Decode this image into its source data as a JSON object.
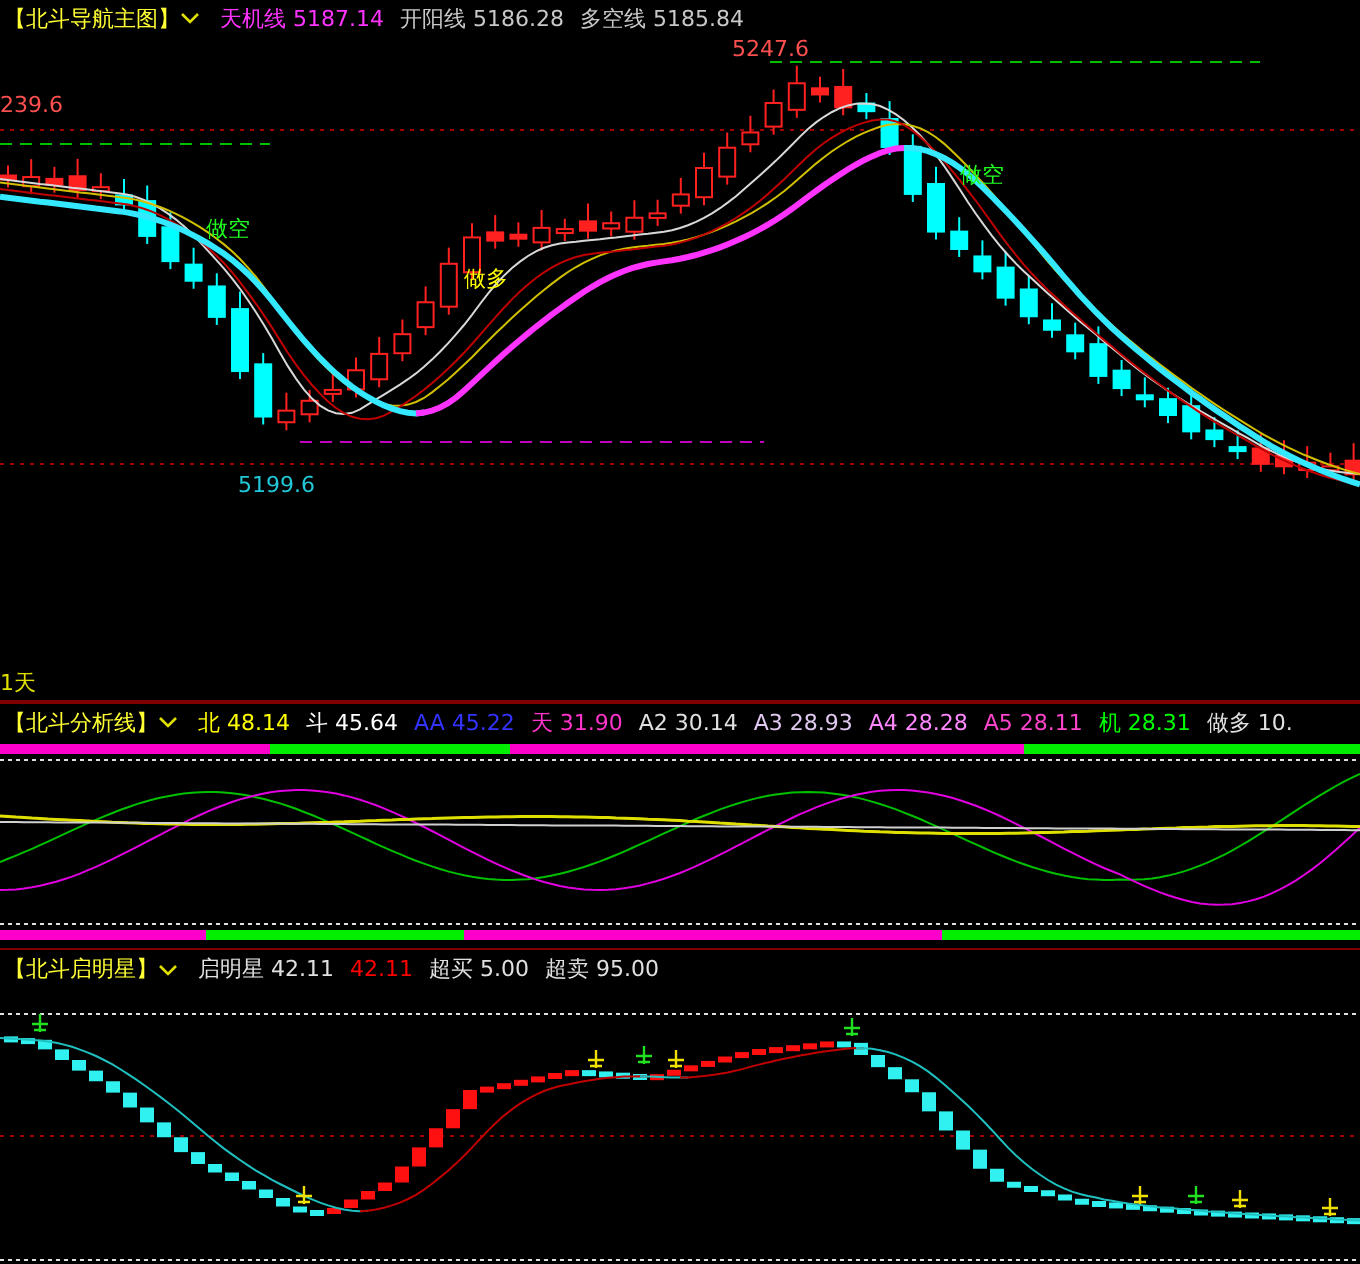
{
  "main_panel": {
    "title": "【北斗导航主图】",
    "indicators": [
      {
        "name": "天机线",
        "value": "5187.14",
        "color": "#ff33ff"
      },
      {
        "name": "开阳线",
        "value": "5186.28",
        "color": "#c8c8c8"
      },
      {
        "name": "多空线",
        "value": "5185.84",
        "color": "#c8c8c8"
      }
    ],
    "price_labels": [
      {
        "text": "5247.6",
        "kind": "high"
      },
      {
        "text": "239.6",
        "kind": "high"
      },
      {
        "text": "5199.6",
        "kind": "low"
      }
    ],
    "signals": [
      {
        "text": "做空",
        "kind": "short"
      },
      {
        "text": "做多",
        "kind": "long"
      },
      {
        "text": "做空",
        "kind": "short"
      }
    ],
    "period": "1天"
  },
  "analysis_panel": {
    "title": "【北斗分析线】",
    "indicators": [
      {
        "name": "北",
        "value": "48.14",
        "color": "#ffff00"
      },
      {
        "name": "斗",
        "value": "45.64",
        "color": "#ffffff"
      },
      {
        "name": "AA",
        "value": "45.22",
        "color": "#3333ff"
      },
      {
        "name": "天",
        "value": "31.90",
        "color": "#ff33cc"
      },
      {
        "name": "A2",
        "value": "30.14",
        "color": "#e0e0e0"
      },
      {
        "name": "A3",
        "value": "28.93",
        "color": "#e0c8f0"
      },
      {
        "name": "A4",
        "value": "28.28",
        "color": "#ff88ff"
      },
      {
        "name": "A5",
        "value": "28.11",
        "color": "#ff44cc"
      },
      {
        "name": "机",
        "value": "28.31",
        "color": "#00ff00"
      },
      {
        "name": "做多",
        "value": "10.",
        "color": "#e0e0e0"
      }
    ]
  },
  "star_panel": {
    "title": "【北斗启明星】",
    "indicators": [
      {
        "name": "启明星",
        "value": "42.11",
        "color": "#e0e0e0"
      },
      {
        "value": "42.11",
        "color": "#ff0000"
      },
      {
        "name": "超买",
        "value": "5.00",
        "color": "#e0e0e0"
      },
      {
        "name": "超卖",
        "value": "95.00",
        "color": "#e0e0e0"
      }
    ]
  }
}
